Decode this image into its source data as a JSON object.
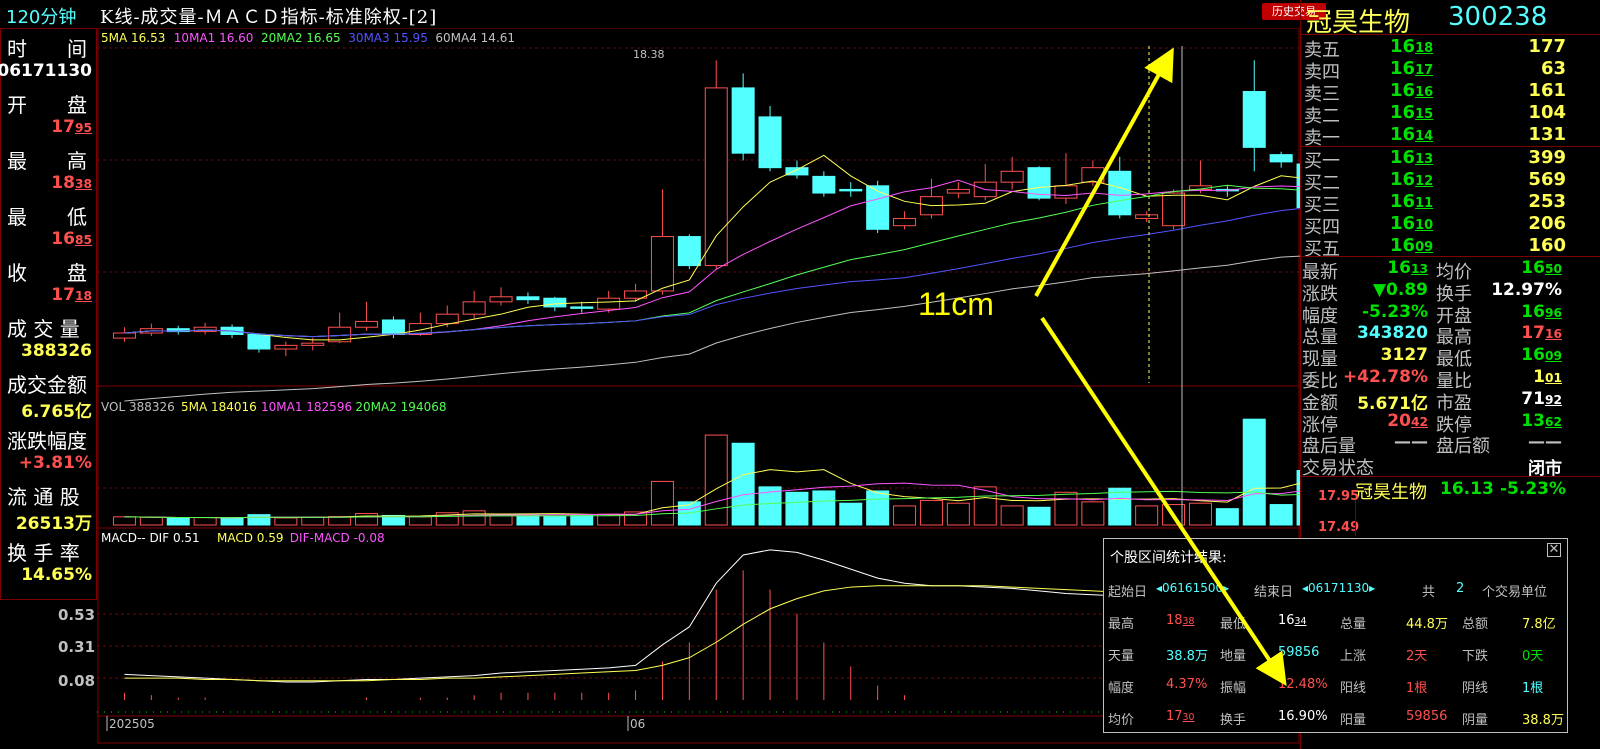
{
  "header": {
    "period": "120分钟",
    "title": "K线-成交量-ＭＡＣＤ指标-标准除权-[2]",
    "history_button": "历史交易"
  },
  "ma_legend": [
    {
      "label": "5MA 16.53",
      "color": "#ffff54"
    },
    {
      "label": "10MA1 16.60",
      "color": "#ff54ff"
    },
    {
      "label": "20MA2 16.65",
      "color": "#54ff54"
    },
    {
      "label": "30MA3 15.95",
      "color": "#5454ff"
    },
    {
      "label": "60MA4 14.61",
      "color": "#c0c0c0"
    }
  ],
  "vol_legend": [
    {
      "label": "VOL 388326",
      "color": "#c0c0c0"
    },
    {
      "label": "5MA 184016",
      "color": "#ffff54"
    },
    {
      "label": "10MA1 182596",
      "color": "#ff54ff"
    },
    {
      "label": "20MA2 194068",
      "color": "#54ff54"
    }
  ],
  "macd_legend": [
    {
      "label": "MACD-- DIF 0.51",
      "color": "#ffffff"
    },
    {
      "label": "MACD 0.59",
      "color": "#ffff54"
    },
    {
      "label": "DIF-MACD -0.08",
      "color": "#ff54ff"
    }
  ],
  "left_panel": {
    "time_label": "时　　间",
    "time_value": "06171130",
    "open_label": "开　　盘",
    "open_value": "17.95",
    "high_label": "最　　高",
    "high_value": "18.38",
    "low_label": "最　　低",
    "low_value": "16.85",
    "close_label": "收　　盘",
    "close_value": "17.18",
    "volume_label": "成 交 量",
    "volume_value": "388326",
    "amount_label": "成交金额",
    "amount_value": "6.765亿",
    "change_label": "涨跌幅度",
    "change_value": "+3.81%",
    "float_label": "流 通 股",
    "float_value": "26513万",
    "turnover_label": "换 手 率",
    "turnover_value": "14.65%"
  },
  "peak_label": "18.38",
  "macd_axis": [
    "0.53",
    "0.31",
    "0.08"
  ],
  "x_axis": [
    "202505",
    "06"
  ],
  "annotation": "11cm",
  "quote": {
    "name": "冠昊生物",
    "code": "300238",
    "asks": [
      {
        "label": "卖五",
        "price": "16.18",
        "vol": "177"
      },
      {
        "label": "卖四",
        "price": "16.17",
        "vol": "63"
      },
      {
        "label": "卖三",
        "price": "16.16",
        "vol": "161"
      },
      {
        "label": "卖二",
        "price": "16.15",
        "vol": "104"
      },
      {
        "label": "卖一",
        "price": "16.14",
        "vol": "131"
      }
    ],
    "bids": [
      {
        "label": "买一",
        "price": "16.13",
        "vol": "399"
      },
      {
        "label": "买二",
        "price": "16.12",
        "vol": "569"
      },
      {
        "label": "买三",
        "price": "16.11",
        "vol": "253"
      },
      {
        "label": "买四",
        "price": "16.10",
        "vol": "206"
      },
      {
        "label": "买五",
        "price": "16.09",
        "vol": "160"
      }
    ],
    "stats": [
      {
        "l1": "最新",
        "v1": "16.13",
        "c1": "#00e000",
        "l2": "均价",
        "v2": "16.50",
        "c2": "#00e000"
      },
      {
        "l1": "涨跌",
        "v1": "▼0.89",
        "c1": "#00e000",
        "l2": "换手",
        "v2": "12.97%",
        "c2": "#ffffff"
      },
      {
        "l1": "幅度",
        "v1": "-5.23%",
        "c1": "#00e000",
        "l2": "开盘",
        "v2": "16.96",
        "c2": "#00e000"
      },
      {
        "l1": "总量",
        "v1": "343820",
        "c1": "#54ffff",
        "l2": "最高",
        "v2": "17.16",
        "c2": "#ff5050"
      },
      {
        "l1": "现量",
        "v1": "3127",
        "c1": "#ffff54",
        "l2": "最低",
        "v2": "16.09",
        "c2": "#00e000"
      },
      {
        "l1": "委比",
        "v1": "+42.78%",
        "c1": "#ff5050",
        "l2": "量比",
        "v2": "1.01",
        "c2": "#ffff54"
      },
      {
        "l1": "金额",
        "v1": "5.671亿",
        "c1": "#ffff54",
        "l2": "市盈",
        "v2": "71.92",
        "c2": "#ffffff"
      },
      {
        "l1": "涨停",
        "v1": "20.42",
        "c1": "#ff5050",
        "l2": "跌停",
        "v2": "13.62",
        "c2": "#00e000"
      },
      {
        "l1": "盘后量",
        "v1": "——",
        "c1": "#c0c0c0",
        "l2": "盘后额",
        "v2": "——",
        "c2": "#c0c0c0"
      },
      {
        "l1": "交易状态",
        "v1": "",
        "c1": "#c0c0c0",
        "l2": "",
        "v2": "闭市",
        "c2": "#ffffff"
      }
    ],
    "mini": {
      "name": "冠昊生物",
      "price": "16.13",
      "change": "-5.23%",
      "axis": [
        "17.95",
        "17.49"
      ]
    }
  },
  "stats_popup": {
    "title": "个股区间统计结果:",
    "start_label": "起始日",
    "start_value": "◂06161500▸",
    "end_label": "结束日",
    "end_value": "◂06171130▸",
    "total_label": "共",
    "total_value": "2",
    "unit_label": "个交易单位",
    "rows": [
      [
        {
          "t": "最高",
          "c": "#c0c0c0"
        },
        {
          "t": "18.38",
          "c": "#ff5050"
        },
        {
          "t": "最低",
          "c": "#c0c0c0"
        },
        {
          "t": "16.34",
          "c": "#ffffff"
        },
        {
          "t": "总量",
          "c": "#c0c0c0"
        },
        {
          "t": "44.8万",
          "c": "#ffff54"
        },
        {
          "t": "总额",
          "c": "#c0c0c0"
        },
        {
          "t": "7.8亿",
          "c": "#ffff54"
        }
      ],
      [
        {
          "t": "天量",
          "c": "#c0c0c0"
        },
        {
          "t": "38.8万",
          "c": "#54ffff"
        },
        {
          "t": "地量",
          "c": "#c0c0c0"
        },
        {
          "t": "59856",
          "c": "#54ffff"
        },
        {
          "t": "上涨",
          "c": "#c0c0c0"
        },
        {
          "t": "2天",
          "c": "#ff5050"
        },
        {
          "t": "下跌",
          "c": "#c0c0c0"
        },
        {
          "t": "0天",
          "c": "#00e000"
        }
      ],
      [
        {
          "t": "幅度",
          "c": "#c0c0c0"
        },
        {
          "t": "4.37%",
          "c": "#ff5050"
        },
        {
          "t": "振幅",
          "c": "#c0c0c0"
        },
        {
          "t": "12.48%",
          "c": "#ff5050"
        },
        {
          "t": "阳线",
          "c": "#c0c0c0"
        },
        {
          "t": "1根",
          "c": "#ff5050"
        },
        {
          "t": "阴线",
          "c": "#c0c0c0"
        },
        {
          "t": "1根",
          "c": "#54ffff"
        }
      ],
      [
        {
          "t": "均价",
          "c": "#c0c0c0"
        },
        {
          "t": "17.30",
          "c": "#ff5050"
        },
        {
          "t": "换手",
          "c": "#c0c0c0"
        },
        {
          "t": "16.90%",
          "c": "#ffffff"
        },
        {
          "t": "阳量",
          "c": "#c0c0c0"
        },
        {
          "t": "59856",
          "c": "#ff5050"
        },
        {
          "t": "阴量",
          "c": "#c0c0c0"
        },
        {
          "t": "38.8万",
          "c": "#ffff54"
        }
      ]
    ]
  },
  "chart_data": {
    "type": "candlestick",
    "candles": [
      [
        14.55,
        14.62,
        14.7,
        14.5
      ],
      [
        14.62,
        14.68,
        14.75,
        14.58
      ],
      [
        14.68,
        14.64,
        14.72,
        14.6
      ],
      [
        14.64,
        14.7,
        14.76,
        14.6
      ],
      [
        14.7,
        14.6,
        14.74,
        14.55
      ],
      [
        14.6,
        14.4,
        14.62,
        14.35
      ],
      [
        14.4,
        14.45,
        14.5,
        14.3
      ],
      [
        14.45,
        14.48,
        14.55,
        14.38
      ],
      [
        14.5,
        14.7,
        14.9,
        14.48
      ],
      [
        14.7,
        14.78,
        15.05,
        14.65
      ],
      [
        14.8,
        14.6,
        14.85,
        14.55
      ],
      [
        14.6,
        14.75,
        14.9,
        14.58
      ],
      [
        14.75,
        14.88,
        15.0,
        14.7
      ],
      [
        14.88,
        15.05,
        15.2,
        14.82
      ],
      [
        15.05,
        15.12,
        15.25,
        15.0
      ],
      [
        15.12,
        15.08,
        15.18,
        15.02
      ],
      [
        15.1,
        14.98,
        15.12,
        14.92
      ],
      [
        14.98,
        14.96,
        15.05,
        14.9
      ],
      [
        14.95,
        15.1,
        15.2,
        14.9
      ],
      [
        15.1,
        15.2,
        15.3,
        15.05
      ],
      [
        15.2,
        15.95,
        16.6,
        15.15
      ],
      [
        15.95,
        15.55,
        15.98,
        15.5
      ],
      [
        15.55,
        18.0,
        18.38,
        15.5
      ],
      [
        18.0,
        17.1,
        18.2,
        17.0
      ],
      [
        17.6,
        16.9,
        17.75,
        16.85
      ],
      [
        16.9,
        16.8,
        17.0,
        16.75
      ],
      [
        16.78,
        16.55,
        16.85,
        16.5
      ],
      [
        16.6,
        16.58,
        16.7,
        16.5
      ],
      [
        16.65,
        16.05,
        16.72,
        16.0
      ],
      [
        16.1,
        16.2,
        16.3,
        16.05
      ],
      [
        16.25,
        16.5,
        16.75,
        16.2
      ],
      [
        16.55,
        16.6,
        16.7,
        16.48
      ],
      [
        16.5,
        16.7,
        16.95,
        16.45
      ],
      [
        16.7,
        16.85,
        17.05,
        16.6
      ],
      [
        16.9,
        16.48,
        16.92,
        16.45
      ],
      [
        16.48,
        16.65,
        17.1,
        16.4
      ],
      [
        16.7,
        16.9,
        17.0,
        16.65
      ],
      [
        16.85,
        16.25,
        17.05,
        16.2
      ],
      [
        16.2,
        16.25,
        16.3,
        16.15
      ],
      [
        16.1,
        16.55,
        16.6,
        16.05
      ],
      [
        16.6,
        16.65,
        17.0,
        16.55
      ],
      [
        16.6,
        16.58,
        16.65,
        16.5
      ],
      [
        17.95,
        17.18,
        18.38,
        16.85
      ],
      [
        17.08,
        16.98,
        17.12,
        16.9
      ],
      [
        16.95,
        16.35,
        17.0,
        16.3
      ],
      [
        16.3,
        16.15,
        16.32,
        16.09
      ]
    ],
    "volumes": [
      30000,
      28000,
      25000,
      27000,
      24000,
      38000,
      26000,
      28000,
      31000,
      42000,
      35000,
      30000,
      45000,
      52000,
      40000,
      38000,
      33000,
      36000,
      40000,
      48000,
      160000,
      85000,
      330000,
      300000,
      140000,
      120000,
      125000,
      80000,
      125000,
      70000,
      90000,
      80000,
      140000,
      70000,
      65000,
      120000,
      85000,
      135000,
      70000,
      75000,
      80000,
      60000,
      388326,
      75000,
      200000,
      80000
    ],
    "macd_dif": [
      0.15,
      0.14,
      0.13,
      0.12,
      0.11,
      0.1,
      0.09,
      0.09,
      0.1,
      0.11,
      0.11,
      0.12,
      0.13,
      0.14,
      0.16,
      0.17,
      0.18,
      0.19,
      0.2,
      0.22,
      0.38,
      0.52,
      0.86,
      1.08,
      1.12,
      1.1,
      1.04,
      0.97,
      0.9,
      0.86,
      0.84,
      0.84,
      0.83,
      0.82,
      0.8,
      0.78,
      0.77,
      0.76,
      0.73,
      0.7,
      0.65,
      0.6,
      0.57,
      0.51,
      0.45,
      0.4
    ],
    "macd_dea": [
      0.12,
      0.12,
      0.12,
      0.11,
      0.11,
      0.1,
      0.1,
      0.1,
      0.1,
      0.1,
      0.11,
      0.11,
      0.12,
      0.12,
      0.13,
      0.14,
      0.15,
      0.16,
      0.17,
      0.18,
      0.22,
      0.28,
      0.4,
      0.54,
      0.66,
      0.74,
      0.8,
      0.83,
      0.84,
      0.84,
      0.84,
      0.84,
      0.84,
      0.83,
      0.82,
      0.81,
      0.8,
      0.79,
      0.78,
      0.76,
      0.74,
      0.71,
      0.68,
      0.66,
      0.62,
      0.59
    ]
  }
}
